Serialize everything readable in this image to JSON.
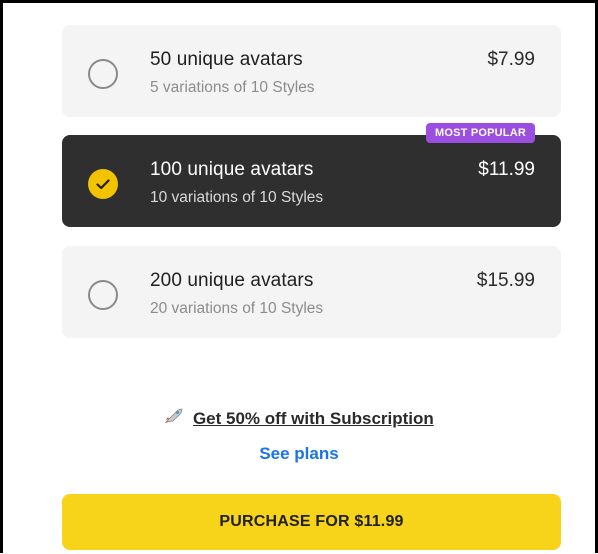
{
  "plans": [
    {
      "title": "50 unique avatars",
      "subtitle": "5 variations of 10 Styles",
      "price": "$7.99",
      "selected": false
    },
    {
      "title": "100 unique avatars",
      "subtitle": "10 variations of 10 Styles",
      "price": "$11.99",
      "selected": true,
      "badge": "MOST POPULAR"
    },
    {
      "title": "200 unique avatars",
      "subtitle": "20 variations of 10 Styles",
      "price": "$15.99",
      "selected": false
    }
  ],
  "promo": {
    "icon": "rocket-icon",
    "text": "Get 50% off with Subscription"
  },
  "see_plans_label": "See plans",
  "purchase_label": "PURCHASE FOR $11.99",
  "colors": {
    "selected_card": "#2f2f2f",
    "badge": "#9b4ee0",
    "check": "#f2c300",
    "link": "#1a73e8",
    "purchase_button": "#f7d31a"
  }
}
